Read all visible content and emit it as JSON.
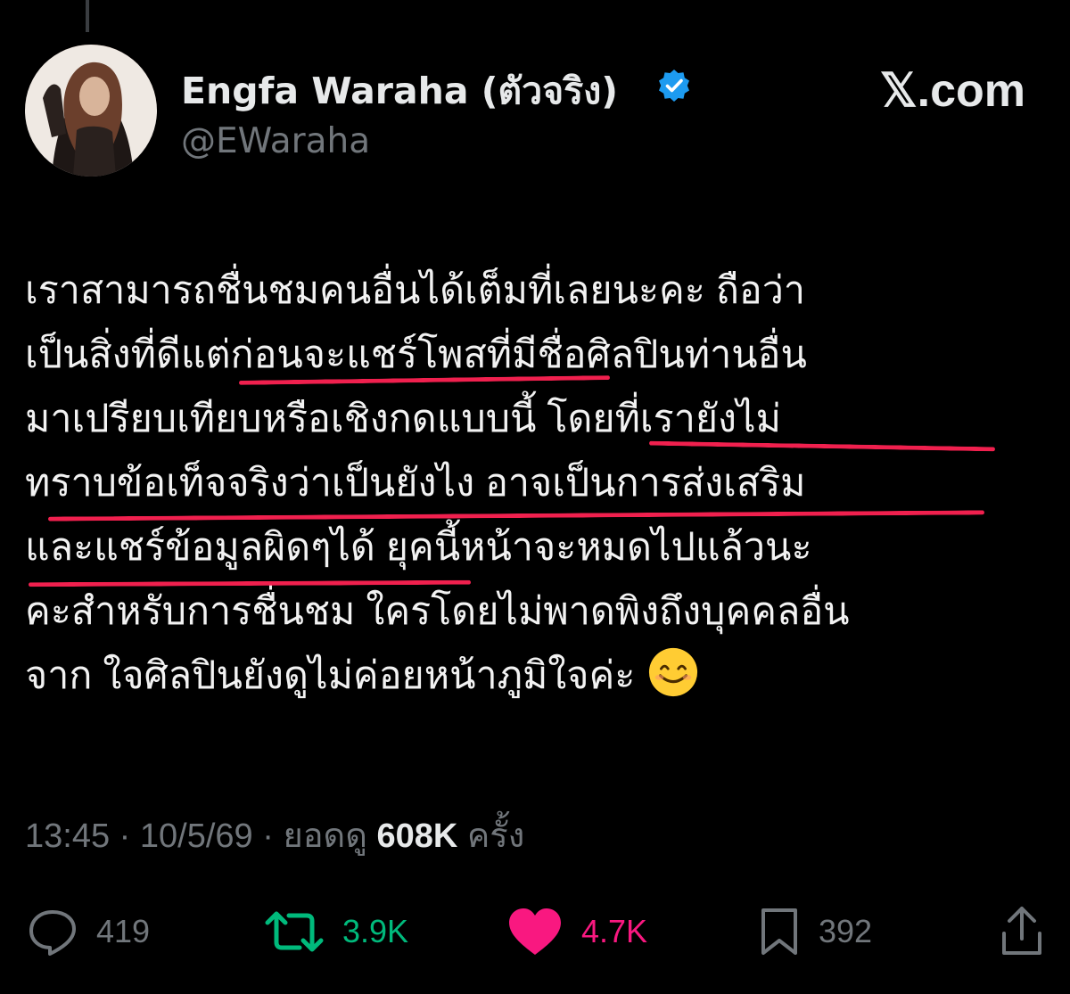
{
  "author": {
    "display_name": "Engfa Waraha (ตัวจริง)",
    "handle": "@EWaraha",
    "verified": true
  },
  "site_label": "𝕏.com",
  "tweet": {
    "lines": [
      "เราสามารถชื่นชมคนอื่นได้เต็มที่เลยนะคะ ถือว่า",
      "เป็นสิ่งที่ดีแต่ก่อนจะแชร์โพสที่มีชื่อศิลปินท่านอื่น",
      "มาเปรียบเทียบหรือเชิงกดแบบนี้ โดยที่เรายังไม่",
      "ทราบข้อเท็จจริงว่าเป็นยังไง อาจเป็นการส่งเสริม",
      "และแชร์ข้อมูลผิดๆได้  ยุคนี้หน้าจะหมดไปแล้วนะ",
      "คะสำหรับการชื่นชม ใครโดยไม่พาดพิงถึงบุคคลอื่น",
      "จาก ใจศิลปินยังดูไม่ค่อยหน้าภูมิใจค่ะ"
    ],
    "emoji": "smiling-face-emoji"
  },
  "meta": {
    "time": "13:45",
    "separator": "·",
    "date": "10/5/69",
    "views_prefix": "ยอดดู",
    "views_count": "608K",
    "views_suffix": "ครั้ง"
  },
  "actions": {
    "replies": "419",
    "reposts": "3.9K",
    "likes": "4.7K",
    "bookmarks": "392"
  },
  "colors": {
    "background": "#000000",
    "text": "#e7e9ea",
    "muted": "#71767b",
    "verified": "#1d9bf0",
    "repost": "#00ba7c",
    "like": "#f91880",
    "annotation": "#f0204e"
  }
}
